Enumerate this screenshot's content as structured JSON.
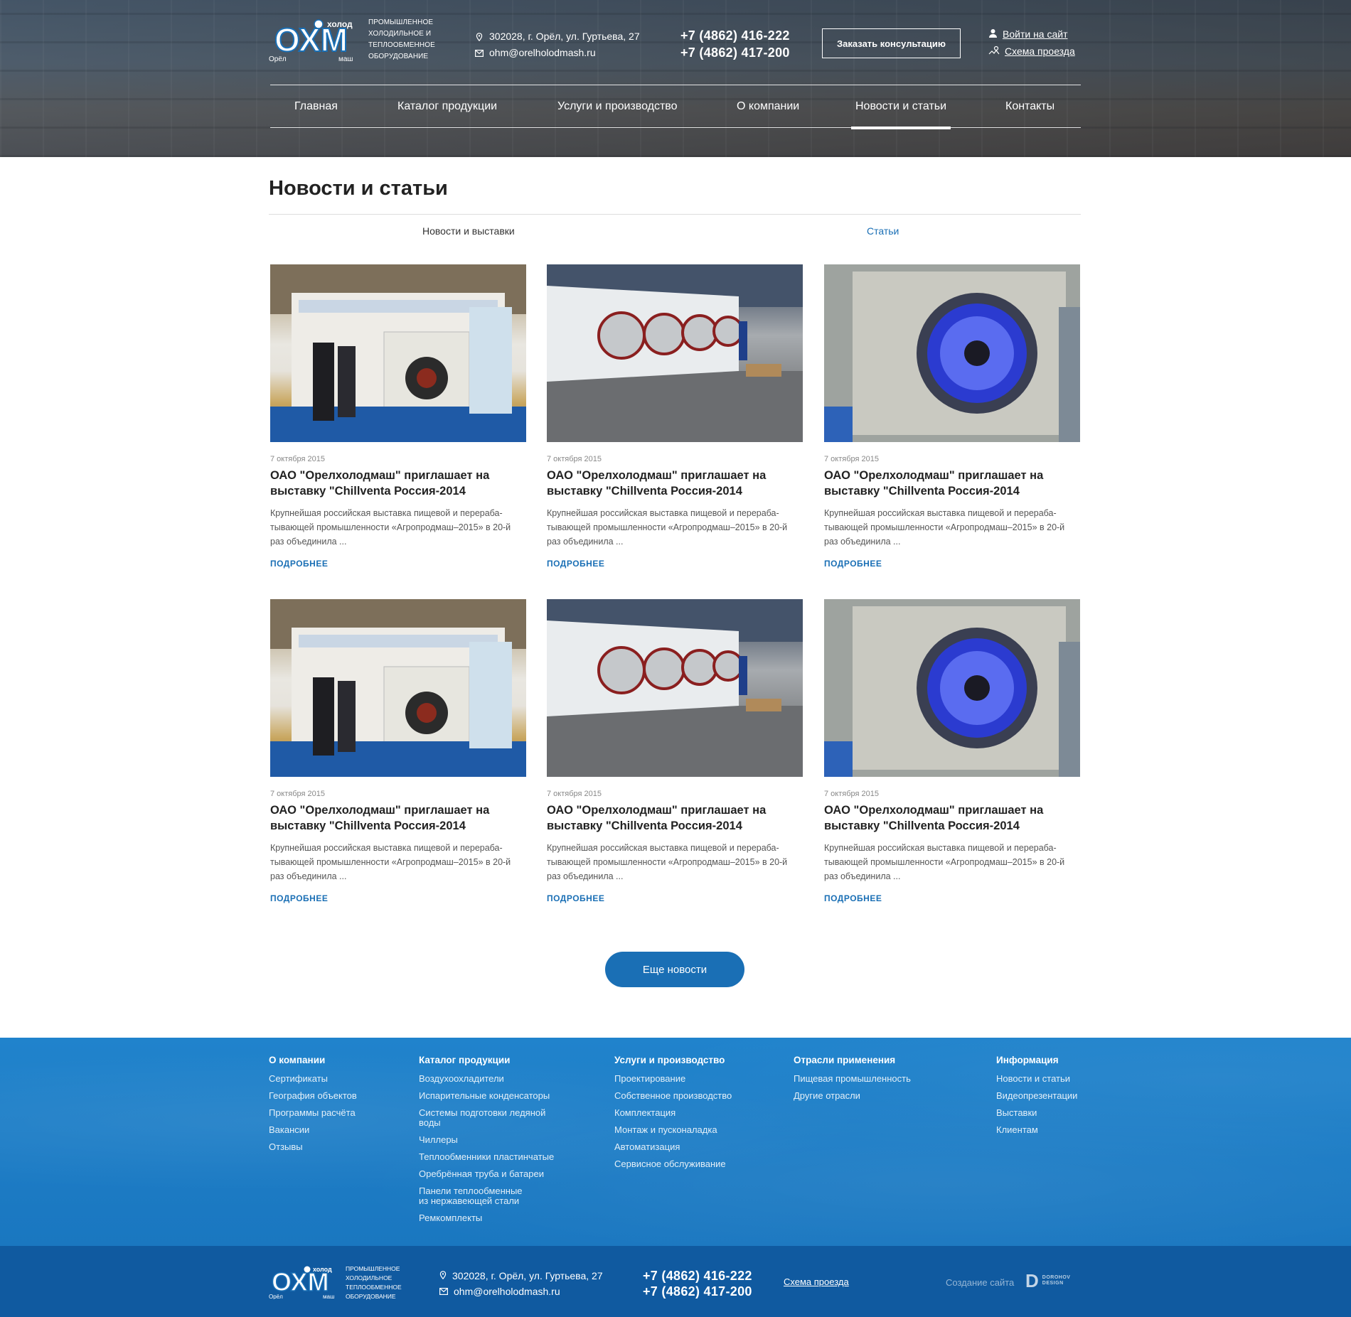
{
  "header": {
    "logo_text": {
      "top": "холод",
      "main": "ОХМ",
      "left": "Орёл",
      "right": "маш"
    },
    "tagline": "Промышленное холодильное и теплообменное оборудование",
    "address": "302028, г. Орёл, ул. Гуртьева, 27",
    "email": "ohm@orelholodmash.ru",
    "phone1": "+7 (4862) 416-222",
    "phone2": "+7 (4862) 417-200",
    "consult_label": "Заказать консультацию",
    "login_label": "Войти на сайт",
    "route_label": "Схема проезда"
  },
  "nav": [
    {
      "label": "Главная"
    },
    {
      "label": "Каталог продукции"
    },
    {
      "label": "Услуги и производство"
    },
    {
      "label": "О компании"
    },
    {
      "label": "Новости и статьи",
      "active": true
    },
    {
      "label": "Контакты"
    }
  ],
  "page": {
    "title": "Новости и статьи",
    "tabs": [
      "Новости и выставки",
      "Статьи"
    ]
  },
  "cards": [
    {
      "image": "expo-booth",
      "date": "7 октября 2015",
      "title": "ОАО \"Орелхолодмаш\" приглашает на выставку \"Chillventa Россия-2014",
      "excerpt": "Крупнейшая российская выставка пищевой и перераба-тывающей промышленности «Агропродмаш–2015» в 20-й раз объединила ...",
      "more": "ПОДРОБНЕЕ"
    },
    {
      "image": "factory-coolers",
      "date": "7 октября 2015",
      "title": "ОАО \"Орелхолодмаш\" приглашает на выставку \"Chillventa Россия-2014",
      "excerpt": "Крупнейшая российская выставка пищевой и перераба-тывающей промышленности «Агропродмаш–2015» в 20-й раз объединила ...",
      "more": "ПОДРОБНЕЕ"
    },
    {
      "image": "fan-unit",
      "date": "7 октября 2015",
      "title": "ОАО \"Орелхолодмаш\" приглашает на выставку \"Chillventa Россия-2014",
      "excerpt": "Крупнейшая российская выставка пищевой и перераба-тывающей промышленности «Агропродмаш–2015» в 20-й раз объединила ...",
      "more": "ПОДРОБНЕЕ"
    },
    {
      "image": "expo-booth",
      "date": "7 октября 2015",
      "title": "ОАО \"Орелхолодмаш\" приглашает на выставку \"Chillventa Россия-2014",
      "excerpt": "Крупнейшая российская выставка пищевой и перераба-тывающей промышленности «Агропродмаш–2015» в 20-й раз объединила ...",
      "more": "ПОДРОБНЕЕ"
    },
    {
      "image": "factory-coolers",
      "date": "7 октября 2015",
      "title": "ОАО \"Орелхолодмаш\" приглашает на выставку \"Chillventa Россия-2014",
      "excerpt": "Крупнейшая российская выставка пищевой и перераба-тывающей промышленности «Агропродмаш–2015» в 20-й раз объединила ...",
      "more": "ПОДРОБНЕЕ"
    },
    {
      "image": "fan-unit",
      "date": "7 октября 2015",
      "title": "ОАО \"Орелхолодмаш\" приглашает на выставку \"Chillventa Россия-2014",
      "excerpt": "Крупнейшая российская выставка пищевой и перераба-тывающей промышленности «Агропродмаш–2015» в 20-й раз объединила ...",
      "more": "ПОДРОБНЕЕ"
    }
  ],
  "load_more": "Еще новости",
  "footer": {
    "columns": [
      {
        "heading": "О компании",
        "links": [
          "Сертификаты",
          "География объектов",
          "Программы расчёта",
          "Вакансии",
          "Отзывы"
        ]
      },
      {
        "heading": "Каталог продукции",
        "links": [
          "Воздухоохладители",
          "Испарительные конденсаторы",
          "Системы подготовки ледяной воды",
          "Чиллеры",
          "Теплообменники пластинчатые",
          "Оребрённая труба и батареи",
          "Панели теплообменные из нержавеющей стали",
          "Ремкомплекты"
        ]
      },
      {
        "heading": "Услуги и производство",
        "links": [
          "Проектирование",
          "Собственное производство",
          "Комплектация",
          "Монтаж и пусконаладка",
          "Автоматизация",
          "Сервисное обслуживание"
        ]
      },
      {
        "heading": "Отрасли применения",
        "links": [
          "Пищевая промышленность",
          "Другие отрасли"
        ]
      },
      {
        "heading": "Информация",
        "links": [
          "Новости и статьи",
          "Видеопрезентации",
          "Выставки",
          "Клиентам"
        ]
      }
    ],
    "tagline": "Промышленное холодильное теплообменное оборудование",
    "address": "302028, г. Орёл, ул. Гуртьева, 27",
    "email": "ohm@orelholodmash.ru",
    "phone1": "+7 (4862) 416-222",
    "phone2": "+7 (4862) 417-200",
    "route_label": "Схема проезда",
    "made_by": "Создание сайта",
    "developer_letter": "D",
    "developer_name_1": "DOROHOV",
    "developer_name_2": "DESIGN"
  },
  "colors": {
    "accent": "#1a6fb5",
    "footer_top": "#1a77c0",
    "footer_bottom": "#105aa0"
  }
}
